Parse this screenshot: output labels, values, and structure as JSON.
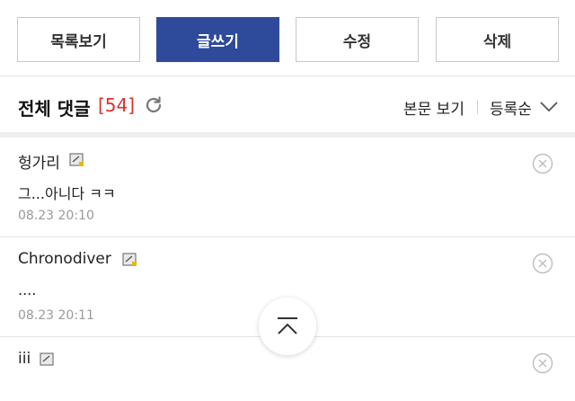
{
  "toolbar": {
    "list_label": "목록보기",
    "write_label": "글쓰기",
    "edit_label": "수정",
    "delete_label": "삭제"
  },
  "comments_header": {
    "title": "전체 댓글",
    "count": "[54]",
    "view_body_label": "본문 보기",
    "sort_label": "등록순"
  },
  "comments": [
    {
      "author": "헝가리",
      "text": "그...아니다 ㅋㅋ",
      "date": "08.23 20:10"
    },
    {
      "author": "Chronodiver",
      "text": "....",
      "date": "08.23 20:11"
    },
    {
      "author": "iii",
      "text": "",
      "date": ""
    }
  ],
  "icons": {
    "refresh": "refresh-icon",
    "sort": "chevron-down-icon",
    "memo": "memo-icon",
    "delete": "close-circle-icon",
    "scroll_top": "chevron-up-icon"
  },
  "colors": {
    "primary": "#2e4a9a",
    "count": "#d9332f",
    "date": "#9a9a9a"
  }
}
